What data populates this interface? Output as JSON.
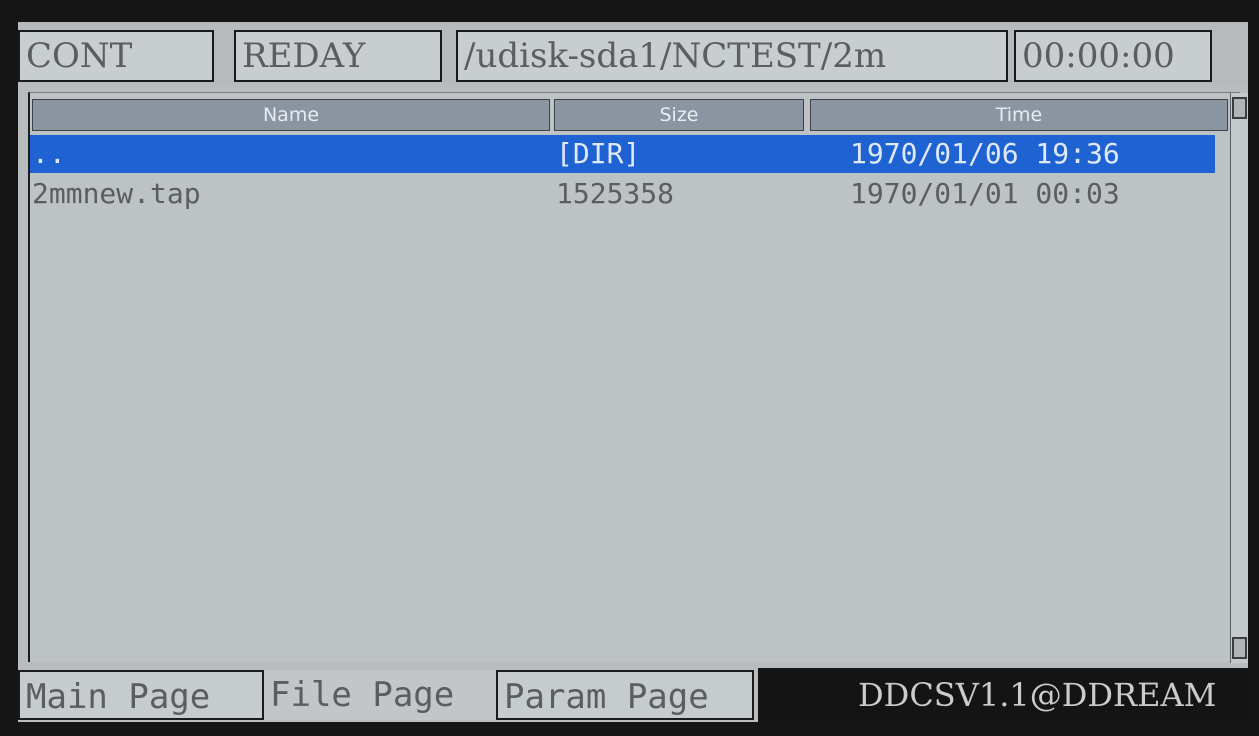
{
  "status_bar": {
    "mode": "CONT",
    "state": "REDAY",
    "path": "/udisk-sda1/NCTEST/2m",
    "timer": "00:00:00"
  },
  "file_table": {
    "columns": [
      "Name",
      "Size",
      "Time"
    ],
    "rows": [
      {
        "name": "..",
        "size": "[DIR]",
        "time": "1970/01/06 19:36",
        "selected": true
      },
      {
        "name": "2mmnew.tap",
        "size": "1525358",
        "time": "1970/01/01 00:03",
        "selected": false
      }
    ]
  },
  "tabs": [
    "Main Page",
    "File Page",
    "Param Page"
  ],
  "brand": "DDCSV1.1@DDREAM",
  "colors": {
    "screen_bg": "#b9bcbe",
    "selection": "#1f62d2",
    "header": "#8b95a1",
    "text": "#5a5d61"
  }
}
